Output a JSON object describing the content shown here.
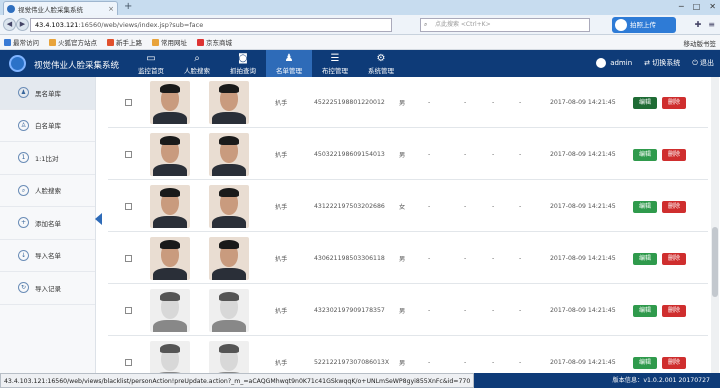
{
  "browser": {
    "tab_title": "视觉伟业人脸采集系统",
    "tab_close": "×",
    "new_tab": "+",
    "url_host": "43.4.103.121",
    "url_path": ":16560/web/views/index.jsp?sub=face",
    "search_placeholder": "点此搜索 <Ctrl+K>",
    "cloud_label": "拍照上传",
    "bookmarks": [
      "最常访问",
      "火狐官方站点",
      "新手上路",
      "常用网址",
      "京东商城"
    ],
    "mobile_bookmarks": "移动版书签"
  },
  "app": {
    "name": "视觉伟业人脸采集系统",
    "nav": [
      {
        "label": "监控首页",
        "icon": "monitor-icon"
      },
      {
        "label": "人脸搜索",
        "icon": "search-icon"
      },
      {
        "label": "抓拍查询",
        "icon": "camera-icon"
      },
      {
        "label": "名单管理",
        "icon": "users-icon"
      },
      {
        "label": "布控管理",
        "icon": "sliders-icon"
      },
      {
        "label": "系统管理",
        "icon": "gear-icon"
      }
    ],
    "active_nav": "名单管理",
    "user": "admin",
    "switch_system": "切换系统",
    "logout": "退出"
  },
  "sidebar": {
    "items": [
      {
        "label": "黑名单库",
        "icon": "people-icon"
      },
      {
        "label": "白名单库",
        "icon": "people-outline-icon"
      },
      {
        "label": "1:1比对",
        "icon": "compare-icon"
      },
      {
        "label": "人脸搜索",
        "icon": "face-search-icon"
      },
      {
        "label": "添加名单",
        "icon": "add-user-icon"
      },
      {
        "label": "导入名单",
        "icon": "import-icon"
      },
      {
        "label": "导入记录",
        "icon": "record-icon"
      }
    ]
  },
  "table": {
    "rows": [
      {
        "type": "扒手",
        "id": "452225198801220012",
        "gender": "男",
        "c1": "-",
        "c2": "-",
        "c3": "-",
        "c4": "-",
        "time": "2017-08-09 14:21:45"
      },
      {
        "type": "扒手",
        "id": "450322198609154013",
        "gender": "男",
        "c1": "-",
        "c2": "-",
        "c3": "-",
        "c4": "-",
        "time": "2017-08-09 14:21:45"
      },
      {
        "type": "扒手",
        "id": "431222197503202686",
        "gender": "女",
        "c1": "-",
        "c2": "-",
        "c3": "-",
        "c4": "-",
        "time": "2017-08-09 14:21:45"
      },
      {
        "type": "扒手",
        "id": "430621198503306118",
        "gender": "男",
        "c1": "-",
        "c2": "-",
        "c3": "-",
        "c4": "-",
        "time": "2017-08-09 14:21:45"
      },
      {
        "type": "扒手",
        "id": "432302197909178357",
        "gender": "男",
        "c1": "-",
        "c2": "-",
        "c3": "-",
        "c4": "-",
        "time": "2017-08-09 14:21:45"
      },
      {
        "type": "扒手",
        "id": "522122197307086013X",
        "gender": "男",
        "c1": "-",
        "c2": "-",
        "c3": "-",
        "c4": "-",
        "time": "2017-08-09 14:21:45"
      }
    ],
    "edit_label": "编辑",
    "delete_label": "删除"
  },
  "statusbar": {
    "link": "43.4.103.121:16560/web/views/blacklist/personAction!preUpdate.action?_m_=aCAQGMhwqt9n0K71c41GSkwqqK/o+UNLmSeWP8gyi855XnFc&id=770",
    "version_label": "版本信息：",
    "version": "v1.0.2.001 20170727"
  }
}
